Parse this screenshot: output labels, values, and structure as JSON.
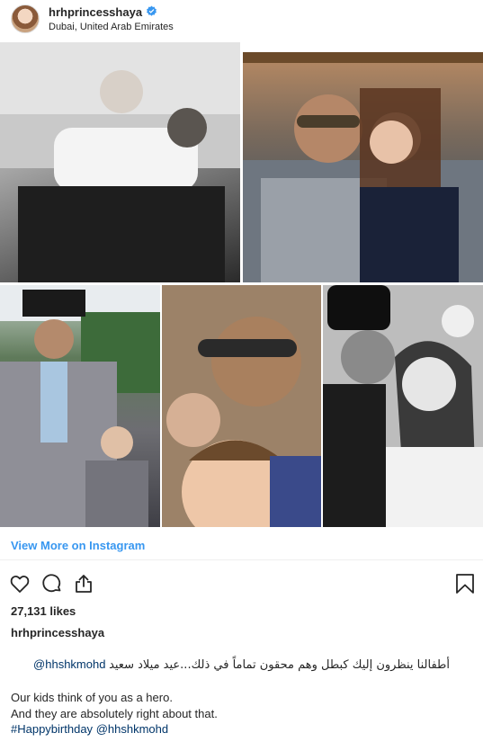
{
  "header": {
    "username": "hrhprincesshaya",
    "location": "Dubai, United Arab Emirates",
    "verified_icon": "verified-badge-icon"
  },
  "colors": {
    "link": "#3897f0",
    "mention": "#003569",
    "text": "#262626",
    "verified": "#3897f0"
  },
  "collage": {
    "photos": [
      {
        "content": "black-and-white photo of man and young boy on sofa"
      },
      {
        "content": "color photo of man with sunglasses and girl"
      },
      {
        "content": "color photo of man in top hat and suit with boy at racecourse"
      },
      {
        "content": "selfie of man with girl and boy"
      },
      {
        "content": "black-and-white photo of man in top hat kissing girl with flower crown"
      }
    ]
  },
  "view_more": "View More on Instagram",
  "actions": {
    "heart_icon": "heart-icon",
    "comment_icon": "comment-icon",
    "share_icon": "share-icon",
    "save_icon": "bookmark-icon"
  },
  "likes": "27,131 likes",
  "caption": {
    "username": "hrhprincesshaya",
    "arabic_mention": "@hhshkmohd",
    "arabic_text": "أطفالنا ينظرون إليك كبطل وهم محقون تماماً في ذلك...عيد ميلاد سعيد",
    "line1": "Our kids think of you as a hero.",
    "line2": "And they are absolutely right about that.",
    "hashtag": "#Happybirthday",
    "mention2": "@hhshkmohd"
  }
}
